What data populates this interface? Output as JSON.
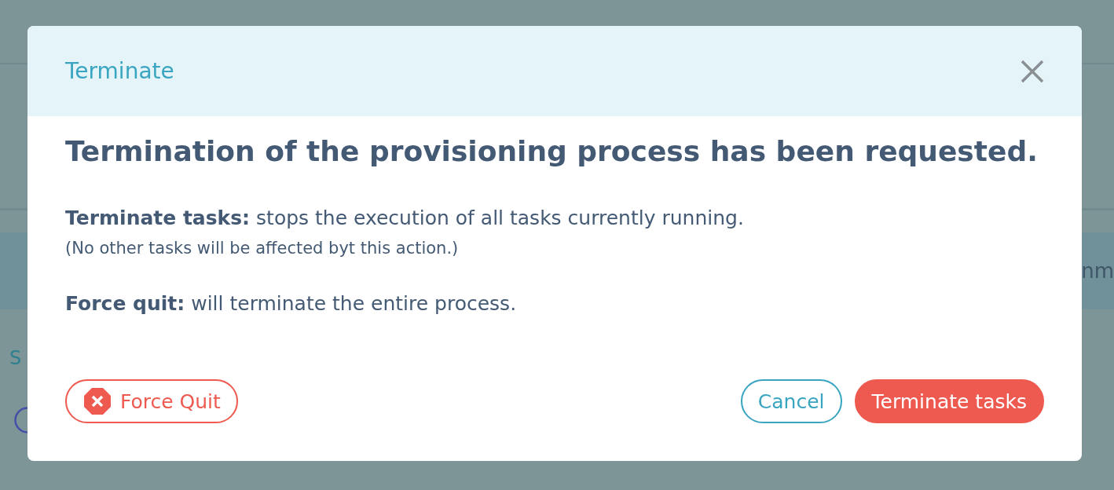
{
  "background": {
    "section_label": "S",
    "tab_label": "nm"
  },
  "dialog": {
    "title": "Terminate",
    "heading": "Termination of the provisioning process has been requested.",
    "paragraphs": [
      {
        "text": "**Terminate tasks:** stops the execution of all tasks currently running.",
        "note": "(No other tasks will be affected byt this action.)"
      },
      {
        "text": "**Force quit:** will terminate the entire process."
      }
    ],
    "buttons": [
      {
        "label": "Force Quit",
        "kind": "outline-danger"
      },
      {
        "label": "Cancel",
        "kind": "outline"
      },
      {
        "label": "Terminate tasks",
        "kind": "danger"
      }
    ]
  }
}
